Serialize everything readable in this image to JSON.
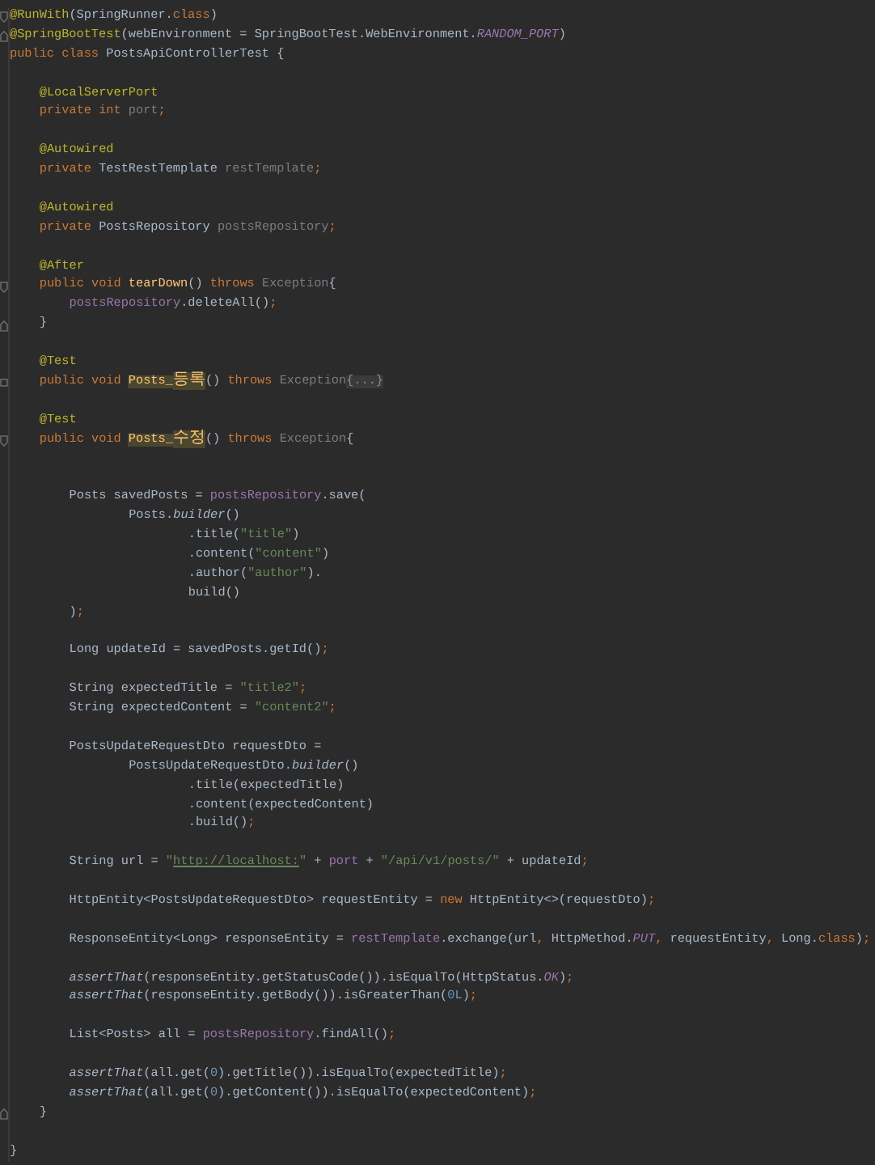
{
  "editor": {
    "lines": [
      {
        "kind": "code",
        "fold_start": true,
        "tokens": [
          {
            "text": "@RunWith",
            "kind": "annotation"
          },
          {
            "text": "(SpringRunner.",
            "kind": "plain"
          },
          {
            "text": "class",
            "kind": "keyword"
          },
          {
            "text": ")",
            "kind": "plain"
          }
        ]
      },
      {
        "kind": "code",
        "fold_end": true,
        "tokens": [
          {
            "text": "@SpringBootTest",
            "kind": "annotation"
          },
          {
            "text": "(webEnvironment = SpringBootTest.WebEnvironment.",
            "kind": "plain"
          },
          {
            "text": "RANDOM_PORT",
            "kind": "constant"
          },
          {
            "text": ")",
            "kind": "plain"
          }
        ]
      },
      {
        "kind": "code",
        "tokens": [
          {
            "text": "public class",
            "kind": "keyword"
          },
          {
            "text": " PostsApiControllerTest {",
            "kind": "plain"
          }
        ],
        "children": [
          {
            "kind": "blank"
          },
          {
            "kind": "code",
            "tokens": [
              {
                "text": "@LocalServerPort",
                "kind": "annotation"
              }
            ]
          },
          {
            "kind": "code",
            "tokens": [
              {
                "text": "private int ",
                "kind": "keyword"
              },
              {
                "text": "port",
                "kind": "unused"
              },
              {
                "text": ";",
                "kind": "keyword"
              }
            ]
          },
          {
            "kind": "blank"
          },
          {
            "kind": "code",
            "tokens": [
              {
                "text": "@Autowired",
                "kind": "annotation"
              }
            ]
          },
          {
            "kind": "code",
            "tokens": [
              {
                "text": "private ",
                "kind": "keyword"
              },
              {
                "text": "TestRestTemplate ",
                "kind": "plain"
              },
              {
                "text": "restTemplate",
                "kind": "unused"
              },
              {
                "text": ";",
                "kind": "keyword"
              }
            ]
          },
          {
            "kind": "blank"
          },
          {
            "kind": "code",
            "tokens": [
              {
                "text": "@Autowired",
                "kind": "annotation"
              }
            ]
          },
          {
            "kind": "code",
            "tokens": [
              {
                "text": "private ",
                "kind": "keyword"
              },
              {
                "text": "PostsRepository ",
                "kind": "plain"
              },
              {
                "text": "postsRepository",
                "kind": "unused"
              },
              {
                "text": ";",
                "kind": "keyword"
              }
            ]
          },
          {
            "kind": "blank"
          },
          {
            "kind": "code",
            "tokens": [
              {
                "text": "@After",
                "kind": "annotation"
              }
            ]
          },
          {
            "kind": "code",
            "fold_start": true,
            "tokens": [
              {
                "text": "public void ",
                "kind": "keyword"
              },
              {
                "text": "tearDown",
                "kind": "method"
              },
              {
                "text": "() ",
                "kind": "plain"
              },
              {
                "text": "throws ",
                "kind": "keyword"
              },
              {
                "text": "Exception",
                "kind": "unused"
              },
              {
                "text": "{",
                "kind": "plain"
              }
            ],
            "children": [
              {
                "kind": "code",
                "tokens": [
                  {
                    "text": "postsRepository",
                    "kind": "field"
                  },
                  {
                    "text": ".deleteAll()",
                    "kind": "plain"
                  },
                  {
                    "text": ";",
                    "kind": "keyword"
                  }
                ]
              }
            ]
          },
          {
            "kind": "code",
            "fold_end": true,
            "tokens": [
              {
                "text": "}",
                "kind": "plain"
              }
            ]
          },
          {
            "kind": "blank"
          },
          {
            "kind": "code",
            "tokens": [
              {
                "text": "@Test",
                "kind": "annotation"
              }
            ]
          },
          {
            "kind": "code",
            "collapsed": true,
            "tokens": [
              {
                "text": "public void ",
                "kind": "keyword"
              },
              {
                "text": "Posts_",
                "kind": "highlight"
              },
              {
                "text": "등록",
                "kind": "highlight-cjk"
              },
              {
                "text": "() ",
                "kind": "plain"
              },
              {
                "text": "throws ",
                "kind": "keyword"
              },
              {
                "text": "Exception",
                "kind": "unused"
              },
              {
                "text": "{...}",
                "kind": "folded"
              }
            ]
          },
          {
            "kind": "blank"
          },
          {
            "kind": "code",
            "tokens": [
              {
                "text": "@Test",
                "kind": "annotation"
              }
            ]
          },
          {
            "kind": "code",
            "fold_start": true,
            "tokens": [
              {
                "text": "public void ",
                "kind": "keyword"
              },
              {
                "text": "Posts_",
                "kind": "highlight"
              },
              {
                "text": "수정",
                "kind": "highlight-cjk"
              },
              {
                "text": "() ",
                "kind": "plain"
              },
              {
                "text": "throws ",
                "kind": "keyword"
              },
              {
                "text": "Exception",
                "kind": "unused"
              },
              {
                "text": "{",
                "kind": "plain"
              }
            ],
            "children": [
              {
                "kind": "blank"
              },
              {
                "kind": "blank"
              },
              {
                "kind": "code",
                "tokens": [
                  {
                    "text": "Posts savedPosts = ",
                    "kind": "plain"
                  },
                  {
                    "text": "postsRepository",
                    "kind": "field"
                  },
                  {
                    "text": ".save(",
                    "kind": "plain"
                  }
                ],
                "children": [
                  {
                    "kind": "code",
                    "tokens": [
                      {
                        "text": "Posts.",
                        "kind": "plain"
                      },
                      {
                        "text": "builder",
                        "kind": "static"
                      },
                      {
                        "text": "()",
                        "kind": "plain"
                      }
                    ],
                    "children": [
                      {
                        "kind": "code",
                        "tokens": [
                          {
                            "text": ".title(",
                            "kind": "plain"
                          },
                          {
                            "text": "\"title\"",
                            "kind": "string"
                          },
                          {
                            "text": ")",
                            "kind": "plain"
                          }
                        ]
                      },
                      {
                        "kind": "code",
                        "tokens": [
                          {
                            "text": ".content(",
                            "kind": "plain"
                          },
                          {
                            "text": "\"content\"",
                            "kind": "string"
                          },
                          {
                            "text": ")",
                            "kind": "plain"
                          }
                        ]
                      },
                      {
                        "kind": "code",
                        "tokens": [
                          {
                            "text": ".author(",
                            "kind": "plain"
                          },
                          {
                            "text": "\"author\"",
                            "kind": "string"
                          },
                          {
                            "text": ").",
                            "kind": "plain"
                          }
                        ]
                      },
                      {
                        "kind": "code",
                        "tokens": [
                          {
                            "text": "build()",
                            "kind": "plain"
                          }
                        ]
                      }
                    ]
                  }
                ]
              },
              {
                "kind": "code",
                "tokens": [
                  {
                    "text": ")",
                    "kind": "plain"
                  },
                  {
                    "text": ";",
                    "kind": "keyword"
                  }
                ]
              },
              {
                "kind": "blank"
              },
              {
                "kind": "code",
                "tokens": [
                  {
                    "text": "Long updateId = savedPosts.getId()",
                    "kind": "plain"
                  },
                  {
                    "text": ";",
                    "kind": "keyword"
                  }
                ]
              },
              {
                "kind": "blank"
              },
              {
                "kind": "code",
                "tokens": [
                  {
                    "text": "String expectedTitle = ",
                    "kind": "plain"
                  },
                  {
                    "text": "\"title2\"",
                    "kind": "string"
                  },
                  {
                    "text": ";",
                    "kind": "keyword"
                  }
                ]
              },
              {
                "kind": "code",
                "tokens": [
                  {
                    "text": "String expectedContent = ",
                    "kind": "plain"
                  },
                  {
                    "text": "\"content2\"",
                    "kind": "string"
                  },
                  {
                    "text": ";",
                    "kind": "keyword"
                  }
                ]
              },
              {
                "kind": "blank"
              },
              {
                "kind": "code",
                "tokens": [
                  {
                    "text": "PostsUpdateRequestDto requestDto =",
                    "kind": "plain"
                  }
                ],
                "children": [
                  {
                    "kind": "code",
                    "tokens": [
                      {
                        "text": "PostsUpdateRequestDto.",
                        "kind": "plain"
                      },
                      {
                        "text": "builder",
                        "kind": "static"
                      },
                      {
                        "text": "()",
                        "kind": "plain"
                      }
                    ],
                    "children": [
                      {
                        "kind": "code",
                        "tokens": [
                          {
                            "text": ".title(expectedTitle)",
                            "kind": "plain"
                          }
                        ]
                      },
                      {
                        "kind": "code",
                        "tokens": [
                          {
                            "text": ".content(expectedContent)",
                            "kind": "plain"
                          }
                        ]
                      },
                      {
                        "kind": "code",
                        "tokens": [
                          {
                            "text": ".build()",
                            "kind": "plain"
                          },
                          {
                            "text": ";",
                            "kind": "keyword"
                          }
                        ]
                      }
                    ]
                  }
                ]
              },
              {
                "kind": "blank"
              },
              {
                "kind": "code",
                "tokens": [
                  {
                    "text": "String url = ",
                    "kind": "plain"
                  },
                  {
                    "text": "\"",
                    "kind": "string"
                  },
                  {
                    "text": "http://localhost:",
                    "kind": "url"
                  },
                  {
                    "text": "\"",
                    "kind": "string"
                  },
                  {
                    "text": " + ",
                    "kind": "plain"
                  },
                  {
                    "text": "port",
                    "kind": "field"
                  },
                  {
                    "text": " + ",
                    "kind": "plain"
                  },
                  {
                    "text": "\"/api/v1/posts/\"",
                    "kind": "string"
                  },
                  {
                    "text": " + updateId",
                    "kind": "plain"
                  },
                  {
                    "text": ";",
                    "kind": "keyword"
                  }
                ]
              },
              {
                "kind": "blank"
              },
              {
                "kind": "code",
                "tokens": [
                  {
                    "text": "HttpEntity<PostsUpdateRequestDto> requestEntity = ",
                    "kind": "plain"
                  },
                  {
                    "text": "new",
                    "kind": "keyword"
                  },
                  {
                    "text": " HttpEntity<>(requestDto)",
                    "kind": "plain"
                  },
                  {
                    "text": ";",
                    "kind": "keyword"
                  }
                ]
              },
              {
                "kind": "blank"
              },
              {
                "kind": "code",
                "tokens": [
                  {
                    "text": "ResponseEntity<Long> responseEntity = ",
                    "kind": "plain"
                  },
                  {
                    "text": "restTemplate",
                    "kind": "field"
                  },
                  {
                    "text": ".exchange(url",
                    "kind": "plain"
                  },
                  {
                    "text": ", ",
                    "kind": "keyword"
                  },
                  {
                    "text": "HttpMethod.",
                    "kind": "plain"
                  },
                  {
                    "text": "PUT",
                    "kind": "constant"
                  },
                  {
                    "text": ", ",
                    "kind": "keyword"
                  },
                  {
                    "text": "requestEntity",
                    "kind": "plain"
                  },
                  {
                    "text": ", ",
                    "kind": "keyword"
                  },
                  {
                    "text": "Long.",
                    "kind": "plain"
                  },
                  {
                    "text": "class",
                    "kind": "keyword"
                  },
                  {
                    "text": ")",
                    "kind": "plain"
                  },
                  {
                    "text": ";",
                    "kind": "keyword"
                  }
                ]
              },
              {
                "kind": "blank"
              },
              {
                "kind": "code",
                "tokens": [
                  {
                    "text": "assertThat",
                    "kind": "static"
                  },
                  {
                    "text": "(responseEntity.getStatusCode()).isEqualTo(HttpStatus.",
                    "kind": "plain"
                  },
                  {
                    "text": "OK",
                    "kind": "constant"
                  },
                  {
                    "text": ")",
                    "kind": "plain"
                  },
                  {
                    "text": ";",
                    "kind": "keyword"
                  }
                ]
              },
              {
                "kind": "code",
                "tokens": [
                  {
                    "text": "assertThat",
                    "kind": "static"
                  },
                  {
                    "text": "(responseEntity.getBody()).isGreaterThan(",
                    "kind": "plain"
                  },
                  {
                    "text": "0L",
                    "kind": "number"
                  },
                  {
                    "text": ")",
                    "kind": "plain"
                  },
                  {
                    "text": ";",
                    "kind": "keyword"
                  }
                ]
              },
              {
                "kind": "blank"
              },
              {
                "kind": "code",
                "tokens": [
                  {
                    "text": "List<Posts> all = ",
                    "kind": "plain"
                  },
                  {
                    "text": "postsRepository",
                    "kind": "field"
                  },
                  {
                    "text": ".findAll()",
                    "kind": "plain"
                  },
                  {
                    "text": ";",
                    "kind": "keyword"
                  }
                ]
              },
              {
                "kind": "blank"
              },
              {
                "kind": "code",
                "tokens": [
                  {
                    "text": "assertThat",
                    "kind": "static"
                  },
                  {
                    "text": "(all.get(",
                    "kind": "plain"
                  },
                  {
                    "text": "0",
                    "kind": "number"
                  },
                  {
                    "text": ").getTitle()).isEqualTo(expectedTitle)",
                    "kind": "plain"
                  },
                  {
                    "text": ";",
                    "kind": "keyword"
                  }
                ]
              },
              {
                "kind": "code",
                "tokens": [
                  {
                    "text": "assertThat",
                    "kind": "static"
                  },
                  {
                    "text": "(all.get(",
                    "kind": "plain"
                  },
                  {
                    "text": "0",
                    "kind": "number"
                  },
                  {
                    "text": ").getContent()).isEqualTo(expectedContent)",
                    "kind": "plain"
                  },
                  {
                    "text": ";",
                    "kind": "keyword"
                  }
                ]
              }
            ]
          },
          {
            "kind": "code",
            "fold_end": true,
            "tokens": [
              {
                "text": "}",
                "kind": "plain"
              }
            ]
          },
          {
            "kind": "blank"
          }
        ]
      },
      {
        "kind": "code",
        "tokens": [
          {
            "text": "}",
            "kind": "plain"
          }
        ]
      }
    ]
  }
}
